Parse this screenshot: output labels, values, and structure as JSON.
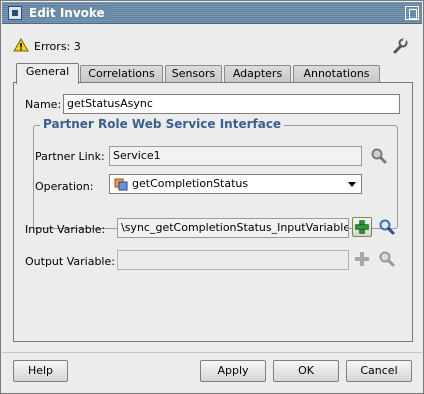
{
  "window": {
    "title": "Edit Invoke"
  },
  "errors": {
    "text": "Errors: 3",
    "icon": "warning-icon"
  },
  "tabs": [
    {
      "label": "General",
      "active": true
    },
    {
      "label": "Correlations",
      "active": false
    },
    {
      "label": "Sensors",
      "active": false
    },
    {
      "label": "Adapters",
      "active": false
    },
    {
      "label": "Annotations",
      "active": false
    }
  ],
  "general": {
    "name_label": "Name:",
    "name_value": "getStatusAsync",
    "group_title": "Partner Role Web Service Interface",
    "partner_link_label": "Partner Link:",
    "partner_link_value": "Service1",
    "operation_label": "Operation:",
    "operation_value": "getCompletionStatus",
    "input_variable_label": "Input Variable:",
    "input_variable_value": "\\sync_getCompletionStatus_InputVariable",
    "output_variable_label": "Output Variable:",
    "output_variable_value": ""
  },
  "buttons": {
    "help": "Help",
    "apply": "Apply",
    "ok": "OK",
    "cancel": "Cancel"
  },
  "colors": {
    "title_bar": "#6a8aa8",
    "group_title": "#3a5f8f",
    "add_icon_green": "#2e9a2e"
  }
}
